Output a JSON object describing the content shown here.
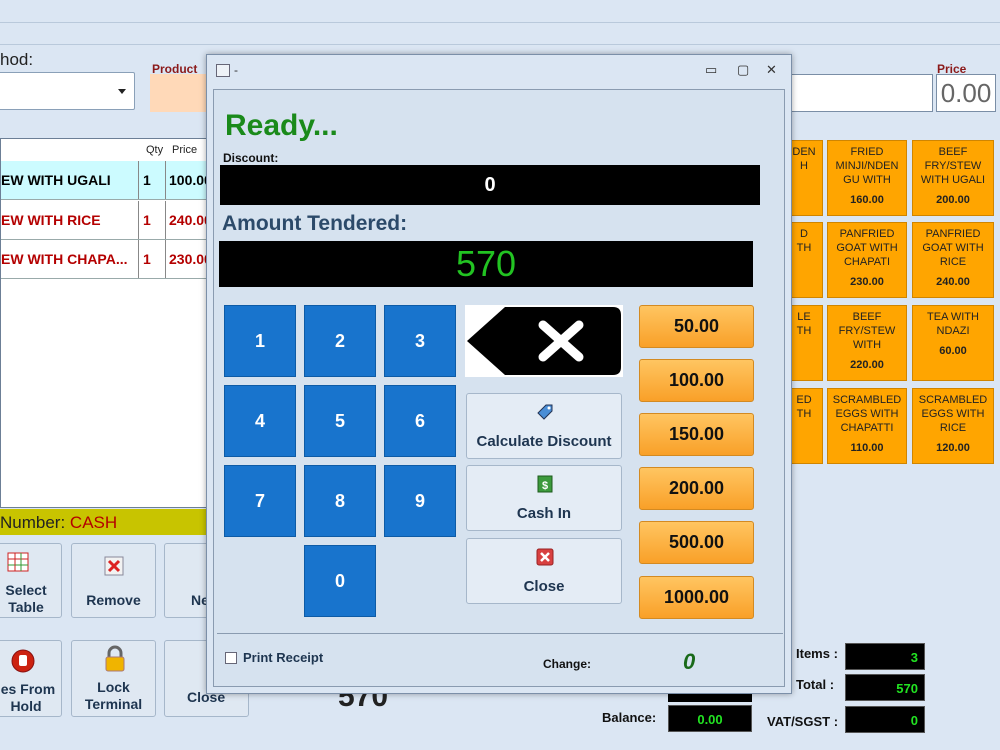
{
  "header": {
    "method_label": "hod:",
    "product_label": "Product",
    "price_label": "Price",
    "price_value": "0.00"
  },
  "order_table": {
    "columns": [
      "Qty",
      "Price"
    ],
    "rows": [
      {
        "name": "EW WITH UGALI",
        "qty": "1",
        "price": "100.00"
      },
      {
        "name": "EW WITH RICE",
        "qty": "1",
        "price": "240.00"
      },
      {
        "name": "EW WITH CHAPA...",
        "qty": "1",
        "price": "230.00"
      }
    ]
  },
  "number_bar": {
    "label": "Number:",
    "value": "CASH"
  },
  "left_buttons": {
    "select_table": [
      "Select",
      "Table"
    ],
    "remove": "Remove",
    "next": "Ne",
    "sales_from_hold": [
      "les From",
      "Hold"
    ],
    "lock_terminal": [
      "Lock",
      "Terminal"
    ],
    "close": "Close"
  },
  "tiles": [
    {
      "name": "DEN\nH",
      "price": ""
    },
    {
      "name": "FRIED MINJI/NDEN GU WITH",
      "price": "160.00"
    },
    {
      "name": "BEEF FRY/STEW WITH UGALI",
      "price": "200.00"
    },
    {
      "name": "D\nTH",
      "price": ""
    },
    {
      "name": "PANFRIED GOAT WITH CHAPATI",
      "price": "230.00"
    },
    {
      "name": "PANFRIED GOAT WITH RICE",
      "price": "240.00"
    },
    {
      "name": "LE\nTH",
      "price": ""
    },
    {
      "name": "BEEF FRY/STEW WITH",
      "price": "220.00"
    },
    {
      "name": "TEA WITH NDAZI",
      "price": "60.00"
    },
    {
      "name": "ED\nTH",
      "price": ""
    },
    {
      "name": "SCRAMBLED EGGS WITH CHAPATTI",
      "price": "110.00"
    },
    {
      "name": "SCRAMBLED EGGS WITH RICE",
      "price": "120.00"
    }
  ],
  "totals": {
    "items_label": "Items :",
    "items_value": "3",
    "total_label": "Total :",
    "total_value": "570",
    "vat_label": "VAT/SGST :",
    "vat_value": "0",
    "balance_label": "Balance:",
    "balance_value": "0.00",
    "big_total": "570"
  },
  "modal": {
    "title": "-",
    "status": "Ready...",
    "discount_label": "Discount:",
    "discount_value": "0",
    "tendered_label": "Amount Tendered:",
    "tendered_value": "570",
    "keys": [
      "1",
      "2",
      "3",
      "4",
      "5",
      "6",
      "7",
      "8",
      "9",
      "0"
    ],
    "calc_discount": "Calculate Discount",
    "cash_in": "Cash In",
    "close": "Close",
    "amounts": [
      "50.00",
      "100.00",
      "150.00",
      "200.00",
      "500.00",
      "1000.00"
    ],
    "print_receipt": "Print Receipt",
    "change_label": "Change:",
    "change_value": "0"
  },
  "colors": {
    "accent": "#1874cd",
    "tile": "#ffa500",
    "ready": "#1a8a1a"
  }
}
